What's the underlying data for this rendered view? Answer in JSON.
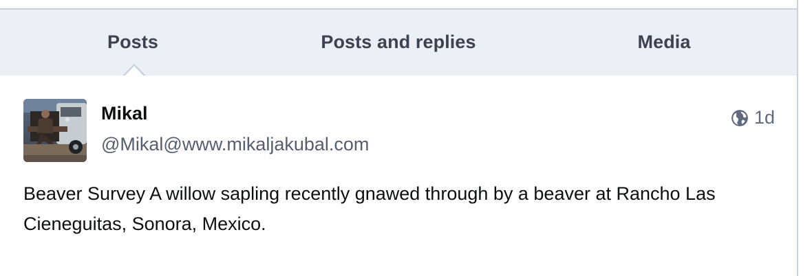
{
  "tabs": [
    {
      "label": "Posts",
      "active": true
    },
    {
      "label": "Posts and replies",
      "active": false
    },
    {
      "label": "Media",
      "active": false
    }
  ],
  "post": {
    "display_name": "Mikal",
    "handle": "@Mikal@www.mikaljakubal.com",
    "visibility_icon": "globe-icon",
    "age": "1d",
    "content": "Beaver Survey A willow sapling recently gnawed through by a beaver at Rancho Las Cieneguitas, Sonora, Mexico."
  },
  "colors": {
    "tab_bar_bg": "#eceff5",
    "border": "#c9d0de",
    "tab_text": "#3c424f",
    "handle_text": "#565d6e",
    "meta_text": "#606a7e"
  }
}
